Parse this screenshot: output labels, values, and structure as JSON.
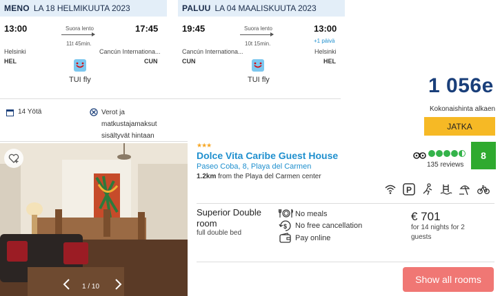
{
  "outbound": {
    "direction": "MENO",
    "date": "LA 18 HELMIKUUTA 2023",
    "depart_time": "13:00",
    "arrive_time": "17:45",
    "flight_type": "Suora lento",
    "duration": "11t 45min.",
    "from_city": "Helsinki",
    "from_code": "HEL",
    "to_city": "Cancún Internationa...",
    "to_code": "CUN",
    "carrier": "TUI fly"
  },
  "return": {
    "direction": "PALUU",
    "date": "LA 04 MAALISKUUTA 2023",
    "depart_time": "19:45",
    "arrive_time": "13:00",
    "next_day": "+1 päivä",
    "flight_type": "Suora lento",
    "duration": "10t 15min.",
    "from_city": "Cancún Internationa...",
    "from_code": "CUN",
    "to_city": "Helsinki",
    "to_code": "HEL",
    "carrier": "TUI fly"
  },
  "nights": "14 Yötä",
  "taxes": [
    "Verot ja",
    "matkustajamaksut",
    "sisältyvät hintaan"
  ],
  "total": {
    "price": "1 056e",
    "label": "Kokonaishinta alkaen",
    "button": "JATKA"
  },
  "hotel": {
    "stars": "★★★",
    "name": "Dolce Vita Caribe Guest House",
    "address": "Paseo Coba, 8, Playa del Carmen",
    "distance_bold": "1.2km",
    "distance_rest": " from the Playa del Carmen center",
    "reviews": "135 reviews",
    "score": "8",
    "rating_bubbles": 4.5,
    "photo_counter": "1 / 10",
    "room_name": [
      "Superior Double",
      "room"
    ],
    "room_bed": "full double bed",
    "features": [
      "No meals",
      "No free cancellation",
      "Pay online"
    ],
    "room_price": "€ 701",
    "price_note": [
      "for 14 nights for 2",
      "guests"
    ],
    "show_rooms": "Show all rooms"
  },
  "amenities": [
    "wifi-icon",
    "parking-icon",
    "kids-club-icon",
    "pool-icon",
    "beach-icon",
    "bicycle-icon"
  ],
  "colors": {
    "header_bg": "#e3eef8",
    "price_blue": "#1a3f7a",
    "link_blue": "#1e8fce",
    "jatka_yellow": "#f6b925",
    "score_green": "#2faa2f",
    "show_rooms_red": "#f07774"
  }
}
